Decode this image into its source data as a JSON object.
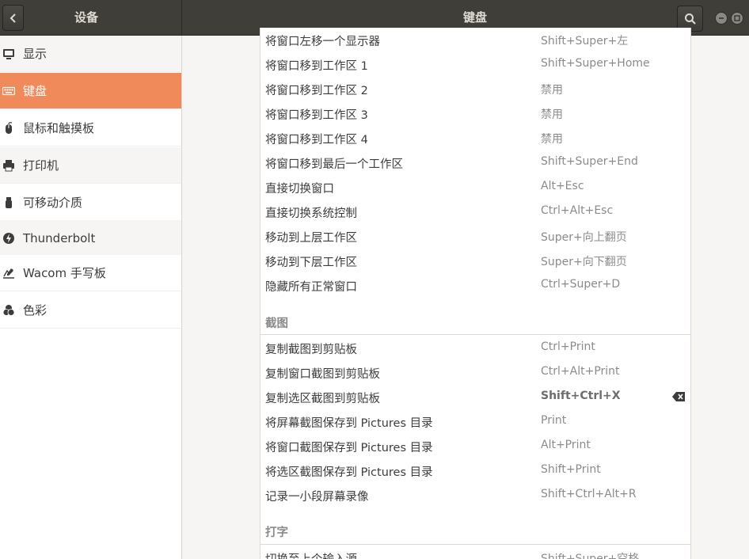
{
  "header": {
    "left_title": "设备",
    "main_title": "键盘",
    "back_icon": "go-previous-icon",
    "search_icon": "search-icon"
  },
  "window_controls": [
    "minimize",
    "maximize",
    "close"
  ],
  "sidebar": {
    "items": [
      {
        "label": "显示",
        "icon": "display-icon"
      },
      {
        "label": "键盘",
        "icon": "keyboard-icon",
        "active": true
      },
      {
        "label": "鼠标和触摸板",
        "icon": "mouse-icon"
      },
      {
        "label": "打印机",
        "icon": "printer-icon"
      },
      {
        "label": "可移动介质",
        "icon": "removable-media-icon"
      },
      {
        "label": "Thunderbolt",
        "icon": "thunderbolt-icon"
      },
      {
        "label": "Wacom 手写板",
        "icon": "tablet-icon"
      },
      {
        "label": "色彩",
        "icon": "color-icon"
      }
    ]
  },
  "shortcuts": {
    "windows": [
      {
        "name": "将窗口左移一个显示器",
        "accel": "Shift+Super+左"
      },
      {
        "name": "将窗口移到工作区 1",
        "accel": "Shift+Super+Home"
      },
      {
        "name": "将窗口移到工作区 2",
        "accel": "禁用"
      },
      {
        "name": "将窗口移到工作区 3",
        "accel": "禁用"
      },
      {
        "name": "将窗口移到工作区 4",
        "accel": "禁用"
      },
      {
        "name": "将窗口移到最后一个工作区",
        "accel": "Shift+Super+End"
      },
      {
        "name": "直接切换窗口",
        "accel": "Alt+Esc"
      },
      {
        "name": "直接切换系统控制",
        "accel": "Ctrl+Alt+Esc"
      },
      {
        "name": "移动到上层工作区",
        "accel": "Super+向上翻页"
      },
      {
        "name": "移动到下层工作区",
        "accel": "Super+向下翻页"
      },
      {
        "name": "隐藏所有正常窗口",
        "accel": "Ctrl+Super+D"
      }
    ],
    "screenshots_title": "截图",
    "screenshots": [
      {
        "name": "复制截图到剪贴板",
        "accel": "Ctrl+Print"
      },
      {
        "name": "复制窗口截图到剪贴板",
        "accel": "Ctrl+Alt+Print"
      },
      {
        "name": "复制选区截图到剪贴板",
        "accel": "Shift+Ctrl+X",
        "custom": true
      },
      {
        "name": "将屏幕截图保存到 Pictures 目录",
        "accel": "Print"
      },
      {
        "name": "将窗口截图保存到 Pictures 目录",
        "accel": "Alt+Print"
      },
      {
        "name": "将选区截图保存到 Pictures 目录",
        "accel": "Shift+Print"
      },
      {
        "name": "记录一小段屏幕录像",
        "accel": "Shift+Ctrl+Alt+R"
      }
    ],
    "typing_title": "打字",
    "typing": [
      {
        "name": "切换至上个输入源",
        "accel": "Shift+Super+空格"
      }
    ]
  },
  "colors": {
    "accent": "#f08a5a",
    "headerbar": "#3f3e39"
  }
}
